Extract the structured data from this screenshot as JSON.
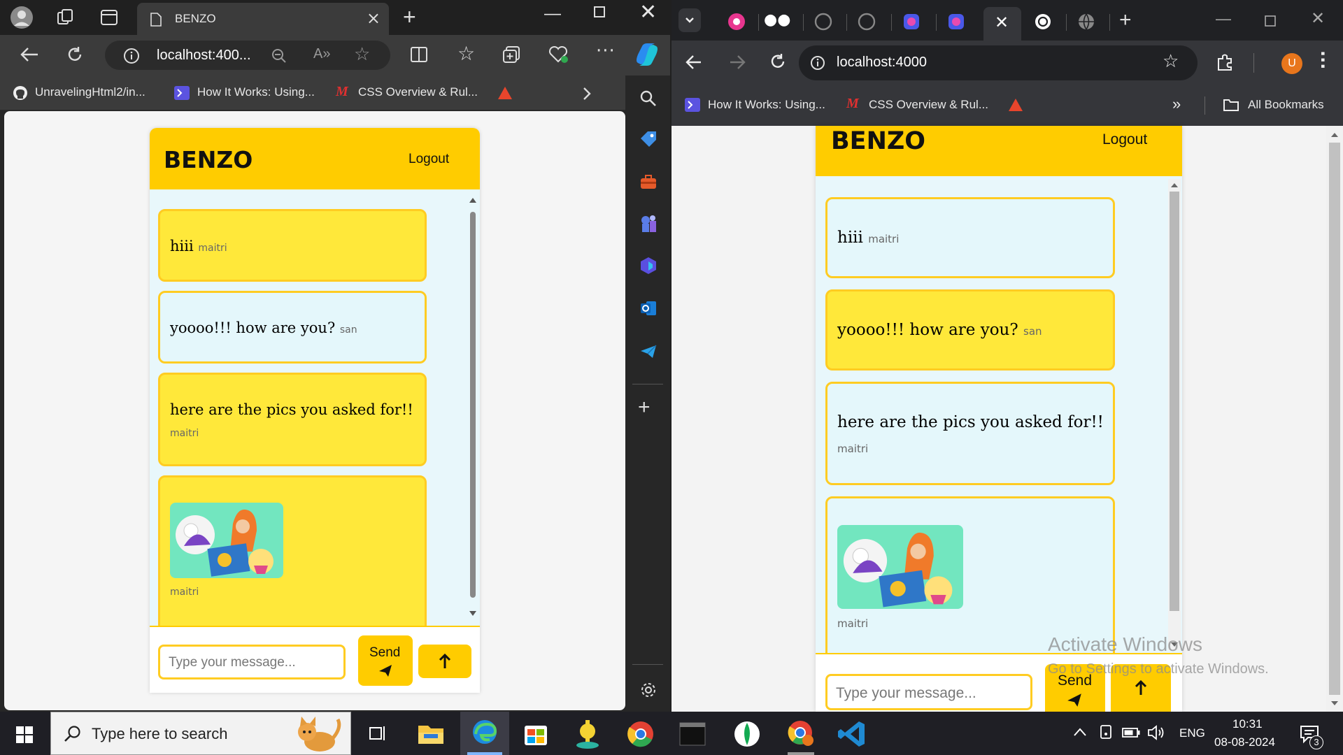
{
  "edge": {
    "tab_title": "BENZO",
    "address": "localhost:400...",
    "bookmarks": [
      "UnravelingHtml2/in...",
      "How It Works: Using...",
      "CSS Overview & Rul..."
    ]
  },
  "chrome": {
    "address": "localhost:4000",
    "bookmarks": [
      "How It Works: Using...",
      "CSS Overview & Rul..."
    ],
    "all_bookmarks": "All Bookmarks",
    "profile_initial": "U"
  },
  "chat": {
    "brand": "BENZO",
    "logout": "Logout",
    "messages": [
      {
        "text": "hiii",
        "user": "maitri"
      },
      {
        "text": "yoooo!!! how are you?",
        "user": "san"
      },
      {
        "text": "here are the pics you asked for!!",
        "user": "maitri"
      },
      {
        "text": "",
        "user": "maitri",
        "has_image": true
      }
    ],
    "input_placeholder": "Type your message...",
    "send_label": "Send"
  },
  "watermark": {
    "title": "Activate Windows",
    "subtitle": "Go to Settings to activate Windows."
  },
  "taskbar": {
    "search_placeholder": "Type here to search",
    "language": "ENG",
    "time": "10:31",
    "date": "08-08-2024",
    "notification_count": "3"
  },
  "colors": {
    "accent": "#ffcc00",
    "bubble_yellow": "#ffe83a",
    "bubble_blue": "#e4f7fb"
  }
}
